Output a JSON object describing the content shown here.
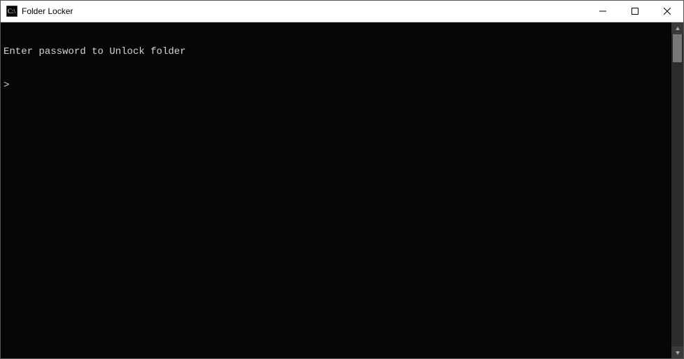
{
  "window": {
    "title": "Folder Locker"
  },
  "console": {
    "message": "Enter password to Unlock folder",
    "prompt": ">",
    "input_value": ""
  }
}
